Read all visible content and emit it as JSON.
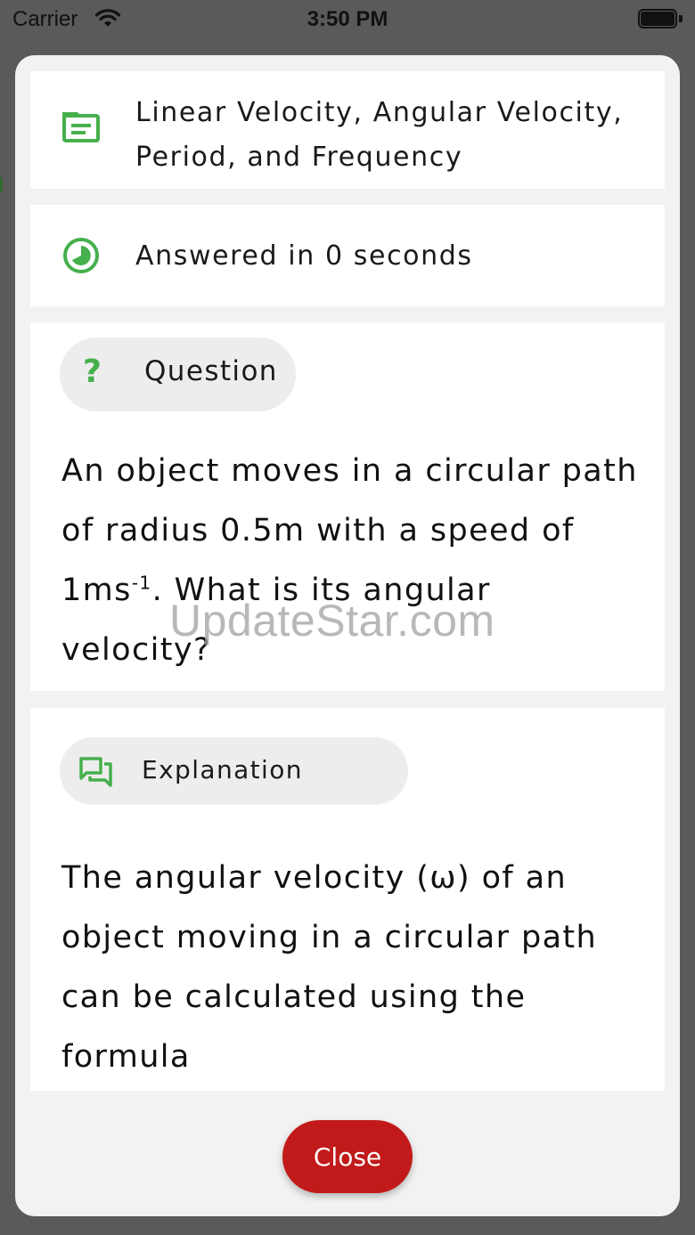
{
  "status_bar": {
    "carrier": "Carrier",
    "time": "3:50 PM"
  },
  "background": {
    "fragment": ")"
  },
  "topic": {
    "icon": "article-icon",
    "title": "Linear Velocity, Angular Velocity, Period, and Frequency"
  },
  "answer_time": {
    "icon": "timer-icon",
    "text": "Answered in 0 seconds"
  },
  "question": {
    "badge_icon": "question-mark-icon",
    "badge_label": "Question",
    "text_before_sup": "An object moves in a circular path of radius 0.5m with a speed of 1ms",
    "superscript": "-1",
    "text_after_sup": ". What is its angular velocity?"
  },
  "explanation": {
    "badge_icon": "forum-icon",
    "badge_label": "Explanation",
    "text": "The angular velocity (ω) of an object moving in a circular path can be calculated using the formula"
  },
  "watermark": "UpdateStar.com",
  "close_button": "Close",
  "colors": {
    "accent_green": "#46b04c",
    "close_red": "#c21a1a",
    "overlay": "#5a5a5a",
    "modal_bg": "#f2f2f2"
  }
}
